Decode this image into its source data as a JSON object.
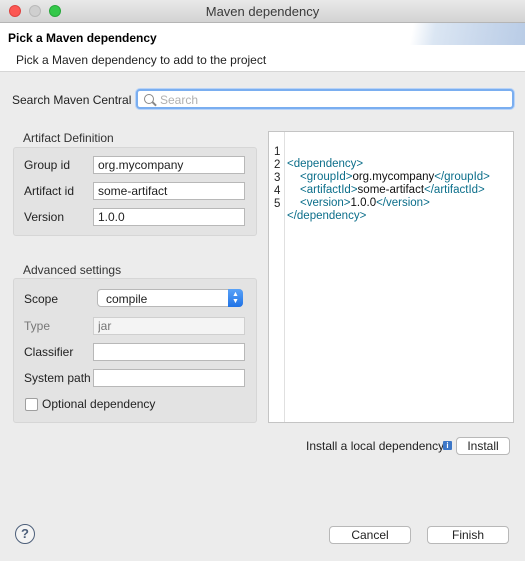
{
  "window": {
    "title": "Maven dependency"
  },
  "header": {
    "title": "Pick a Maven dependency",
    "subtitle": "Pick a Maven dependency to add to the project"
  },
  "search": {
    "label": "Search Maven Central",
    "placeholder": "Search",
    "value": ""
  },
  "artifact": {
    "title": "Artifact Definition",
    "group_id_label": "Group id",
    "group_id": "org.mycompany",
    "artifact_id_label": "Artifact id",
    "artifact_id": "some-artifact",
    "version_label": "Version",
    "version": "1.0.0"
  },
  "advanced": {
    "title": "Advanced settings",
    "scope_label": "Scope",
    "scope": "compile",
    "type_label": "Type",
    "type_placeholder": "jar",
    "classifier_label": "Classifier",
    "classifier": "",
    "system_path_label": "System path",
    "system_path": "",
    "optional_label": "Optional dependency",
    "optional_checked": false
  },
  "xml": {
    "lines": [
      {
        "num": "1",
        "open": "<dependency>",
        "text": "",
        "close": ""
      },
      {
        "num": "2",
        "open": "<groupId>",
        "text": "org.mycompany",
        "close": "</groupId>"
      },
      {
        "num": "3",
        "open": "<artifactId>",
        "text": "some-artifact",
        "close": "</artifactId>"
      },
      {
        "num": "4",
        "open": "<version>",
        "text": "1.0.0",
        "close": "</version>"
      },
      {
        "num": "5",
        "open": "</dependency>",
        "text": "",
        "close": ""
      }
    ]
  },
  "install": {
    "label": "Install a local dependency",
    "button": "Install"
  },
  "footer": {
    "help": "?",
    "cancel": "Cancel",
    "finish": "Finish"
  },
  "colors": {
    "accent": "#2b78e4",
    "xml_tag": "#0b6e8a",
    "close_red": "#fc5753",
    "zoom_green": "#34c84a"
  }
}
